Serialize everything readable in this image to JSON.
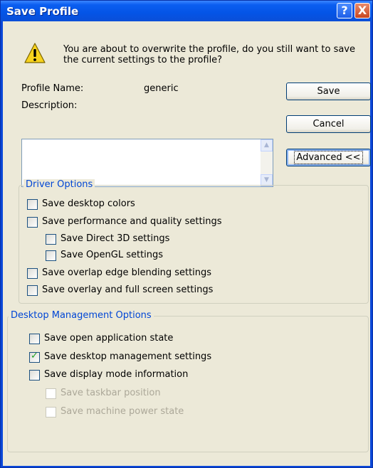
{
  "window": {
    "title": "Save Profile",
    "help_glyph": "?",
    "close_glyph": "X"
  },
  "message": "You are about to overwrite the profile, do you still want to save the current settings to the profile?",
  "profile": {
    "name_label": "Profile Name:",
    "name_value": "generic",
    "description_label": "Description:",
    "description_value": ""
  },
  "buttons": {
    "save": "Save",
    "cancel": "Cancel",
    "advanced": "Advanced <<"
  },
  "driver_options": {
    "legend": "Driver Options",
    "items": [
      {
        "label": "Save desktop colors",
        "checked": false,
        "enabled": true
      },
      {
        "label": "Save performance and quality settings",
        "checked": false,
        "enabled": true
      },
      {
        "label": "Save Direct 3D settings",
        "checked": false,
        "enabled": true
      },
      {
        "label": "Save OpenGL settings",
        "checked": false,
        "enabled": true
      },
      {
        "label": "Save overlap edge blending settings",
        "checked": false,
        "enabled": true
      },
      {
        "label": "Save overlay and full screen settings",
        "checked": false,
        "enabled": true
      }
    ]
  },
  "desktop_options": {
    "legend": "Desktop Management Options",
    "items": [
      {
        "label": "Save open application state",
        "checked": false,
        "enabled": true
      },
      {
        "label": "Save desktop management settings",
        "checked": true,
        "enabled": true
      },
      {
        "label": "Save display mode information",
        "checked": false,
        "enabled": true
      },
      {
        "label": "Save taskbar position",
        "checked": false,
        "enabled": false
      },
      {
        "label": "Save machine power state",
        "checked": false,
        "enabled": false
      }
    ]
  },
  "colors": {
    "title_bar": "#0a4fd8",
    "legend_text": "#0046d5",
    "check_mark": "#21a121",
    "disabled_text": "#aca899"
  }
}
